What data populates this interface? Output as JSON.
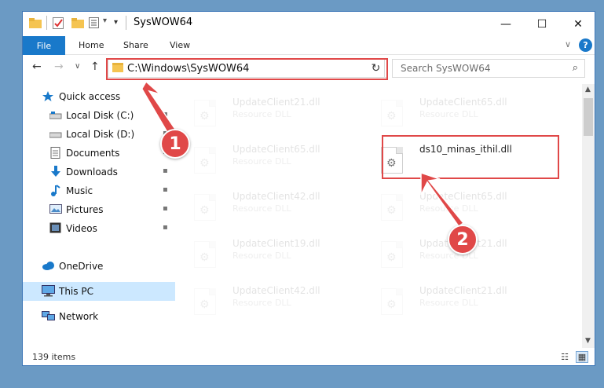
{
  "window": {
    "title": "SysWOW64",
    "minimize_glyph": "—",
    "maximize_glyph": "☐",
    "close_glyph": "✕"
  },
  "quick_access_toolbar": {
    "icons": [
      "folder-icon",
      "properties-check-icon",
      "new-folder-icon",
      "customize-icon"
    ],
    "dropdown_glyph": "▾"
  },
  "ribbon": {
    "tabs": [
      "File",
      "Home",
      "Share",
      "View"
    ],
    "expand_glyph": "∨",
    "help_glyph": "?"
  },
  "navigation": {
    "back_glyph": "←",
    "forward_glyph": "→",
    "recent_glyph": "∨",
    "up_glyph": "↑",
    "address": "C:\\Windows\\SysWOW64",
    "address_dropdown_glyph": "∨",
    "refresh_glyph": "↻",
    "search_placeholder": "Search SysWOW64",
    "search_glyph": "⌕"
  },
  "sidebar": {
    "items": [
      {
        "label": "Quick access",
        "icon": "star-icon",
        "pinned": false,
        "selected": false
      },
      {
        "label": "Local Disk (C:)",
        "icon": "drive-icon",
        "pinned": true,
        "selected": false
      },
      {
        "label": "Local Disk (D:)",
        "icon": "drive-icon",
        "pinned": true,
        "selected": false
      },
      {
        "label": "Documents",
        "icon": "documents-icon",
        "pinned": true,
        "selected": false
      },
      {
        "label": "Downloads",
        "icon": "download-icon",
        "pinned": true,
        "selected": false
      },
      {
        "label": "Music",
        "icon": "music-icon",
        "pinned": true,
        "selected": false
      },
      {
        "label": "Pictures",
        "icon": "pictures-icon",
        "pinned": true,
        "selected": false
      },
      {
        "label": "Videos",
        "icon": "videos-icon",
        "pinned": true,
        "selected": false
      },
      {
        "label": "OneDrive",
        "icon": "cloud-icon",
        "pinned": false,
        "selected": false
      },
      {
        "label": "This PC",
        "icon": "computer-icon",
        "pinned": false,
        "selected": true
      },
      {
        "label": "Network",
        "icon": "network-icon",
        "pinned": false,
        "selected": false
      }
    ],
    "pin_glyph": "📌"
  },
  "files": [
    {
      "name": "UpdateClient21.dll",
      "type": "Resource DLL",
      "faded": true
    },
    {
      "name": "UpdateClient65.dll",
      "type": "Resource DLL",
      "faded": true
    },
    {
      "name": "UpdateClient65.dll",
      "type": "Resource DLL",
      "faded": true
    },
    {
      "name": "ds10_minas_ithil.dll",
      "type": "",
      "faded": false
    },
    {
      "name": "UpdateClient42.dll",
      "type": "Resource DLL",
      "faded": true
    },
    {
      "name": "UpdateClient65.dll",
      "type": "Resource DLL",
      "faded": true
    },
    {
      "name": "UpdateClient19.dll",
      "type": "Resource DLL",
      "faded": true
    },
    {
      "name": "UpdateClient21.dll",
      "type": "Resource DLL",
      "faded": true
    },
    {
      "name": "UpdateClient42.dll",
      "type": "Resource DLL",
      "faded": true
    },
    {
      "name": "UpdateClient21.dll",
      "type": "Resource DLL",
      "faded": true
    }
  ],
  "status_bar": {
    "item_count": "139 items",
    "details_view_glyph": "☷",
    "large_icons_glyph": "▦"
  },
  "annotations": {
    "step1": "1",
    "step2": "2",
    "color": "#e04848"
  },
  "colors": {
    "accent": "#1979ca",
    "selection": "#cce8ff",
    "desktop": "#6b9ac4"
  }
}
